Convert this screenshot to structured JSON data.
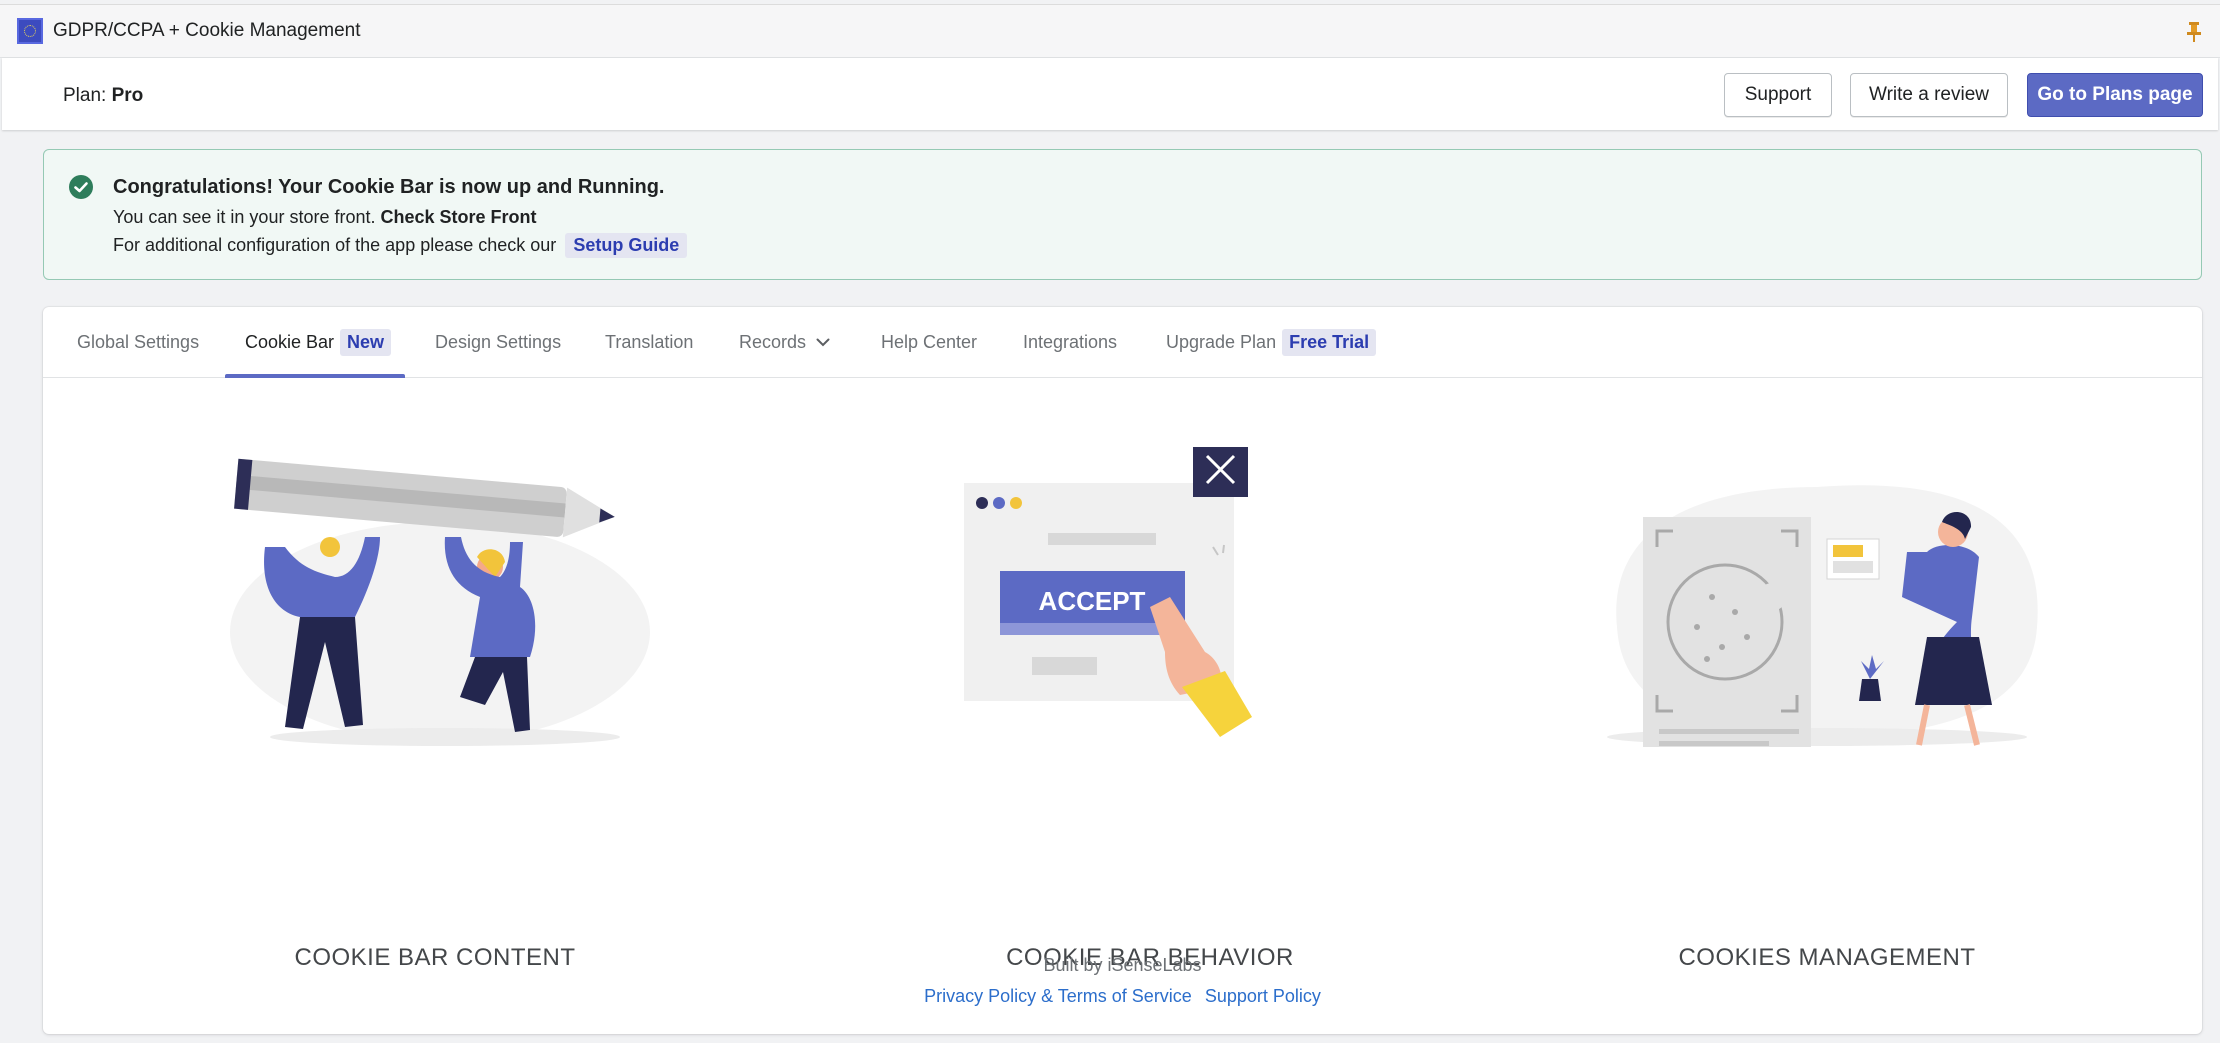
{
  "app": {
    "title": "GDPR/CCPA + Cookie Management"
  },
  "plan": {
    "label": "Plan:",
    "value": "Pro"
  },
  "header_buttons": {
    "support": "Support",
    "review": "Write a review",
    "plans": "Go to Plans page"
  },
  "banner": {
    "title": "Congratulations! Your Cookie Bar is now up and Running.",
    "line1_text": "You can see it in your store front.",
    "line1_bold": "Check Store Front",
    "line2_text": "For additional configuration of the app please check our",
    "line2_link": "Setup Guide"
  },
  "tabs": [
    {
      "label": "Global Settings"
    },
    {
      "label": "Cookie Bar",
      "badge": "New"
    },
    {
      "label": "Design Settings"
    },
    {
      "label": "Translation"
    },
    {
      "label": "Records"
    },
    {
      "label": "Help Center"
    },
    {
      "label": "Integrations"
    },
    {
      "label": "Upgrade Plan",
      "badge": "Free Trial"
    }
  ],
  "features": [
    {
      "label": "COOKIE BAR CONTENT"
    },
    {
      "label": "COOKIE BAR BEHAVIOR",
      "button_text": "ACCEPT"
    },
    {
      "label": "COOKIES MANAGEMENT"
    }
  ],
  "footer": {
    "built_by": "Built by iSenseLabs",
    "privacy": "Privacy Policy & Terms of Service",
    "support_policy": "Support Policy"
  },
  "colors": {
    "primary": "#5c6ac4",
    "success_bg": "#f1f8f5",
    "success_border": "#95c9b4",
    "check": "#2e7d5b",
    "link": "#2c6ecb"
  }
}
